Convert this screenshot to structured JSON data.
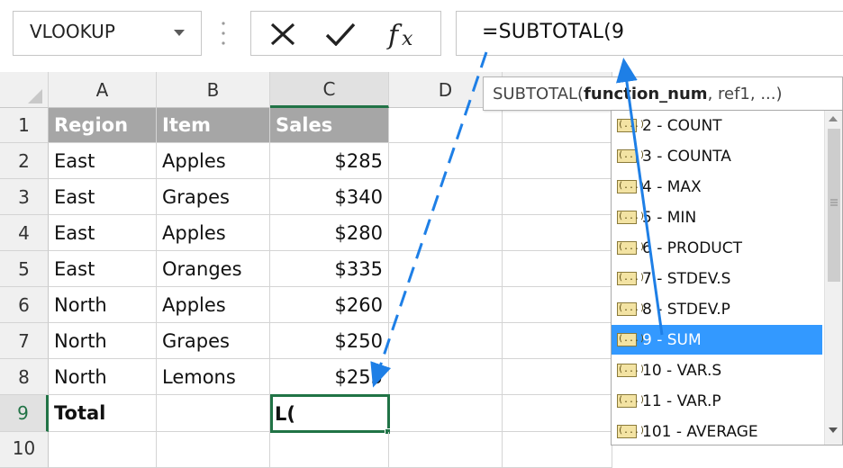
{
  "name_box": {
    "value": "VLOOKUP"
  },
  "formula_bar": {
    "formula": "=SUBTOTAL(9"
  },
  "columns": [
    "A",
    "B",
    "C",
    "D"
  ],
  "rows": [
    {
      "num": "1",
      "a": "Region",
      "b": "Item",
      "c": "Sales"
    },
    {
      "num": "2",
      "a": "East",
      "b": "Apples",
      "c": "$285"
    },
    {
      "num": "3",
      "a": "East",
      "b": "Grapes",
      "c": "$340"
    },
    {
      "num": "4",
      "a": "East",
      "b": "Apples",
      "c": "$280"
    },
    {
      "num": "5",
      "a": "East",
      "b": "Oranges",
      "c": "$335"
    },
    {
      "num": "6",
      "a": "North",
      "b": "Apples",
      "c": "$260"
    },
    {
      "num": "7",
      "a": "North",
      "b": "Grapes",
      "c": "$250"
    },
    {
      "num": "8",
      "a": "North",
      "b": "Lemons",
      "c": "$255"
    },
    {
      "num": "9",
      "a": "Total",
      "b": "",
      "c": "L("
    },
    {
      "num": "10",
      "a": "",
      "b": "",
      "c": ""
    }
  ],
  "tooltip": {
    "fn": "SUBTOTAL(",
    "arg_bold": "function_num",
    "rest": ", ref1, ...)"
  },
  "autocomplete": {
    "icon_text": "(...)",
    "items": [
      "2 - COUNT",
      "3 - COUNTA",
      "4 - MAX",
      "5 - MIN",
      "6 - PRODUCT",
      "7 - STDEV.S",
      "8 - STDEV.P",
      "9 - SUM",
      "10 - VAR.S",
      "11 - VAR.P",
      "101 - AVERAGE"
    ],
    "selected_index": 7
  },
  "colors": {
    "header_fill": "#a6a6a6",
    "selection_blue": "#3399ff",
    "active_cell_border": "#217346",
    "annotation_arrow": "#1e7fe6"
  },
  "icons": [
    "cancel-x-icon",
    "enter-check-icon",
    "fx-icon",
    "dropdown-arrow-icon"
  ]
}
